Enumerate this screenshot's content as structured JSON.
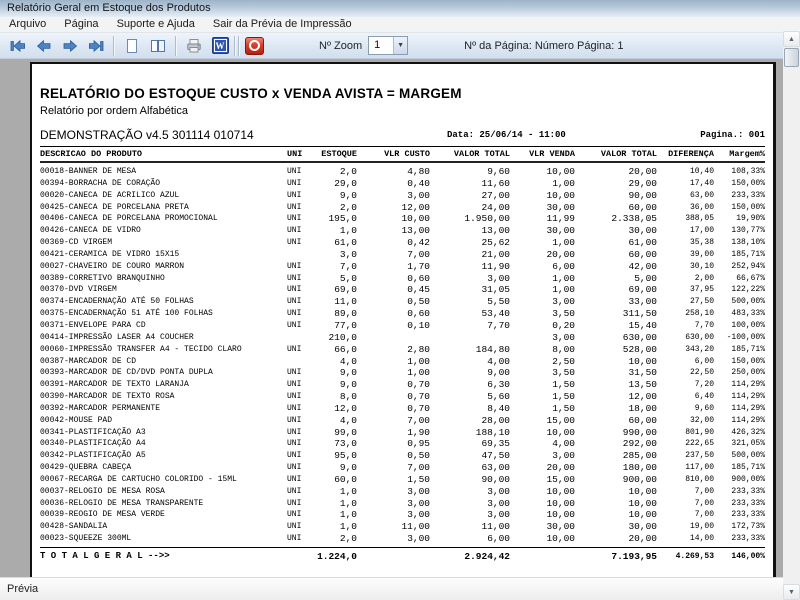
{
  "window": {
    "title": "Relatório Geral em Estoque dos Produtos"
  },
  "menu": {
    "items": [
      "Arquivo",
      "Página",
      "Suporte e Ajuda",
      "Sair da Prévia de Impressão"
    ]
  },
  "toolbar": {
    "icons": [
      "first-page",
      "previous-page",
      "next-page",
      "last-page",
      "single-page-view",
      "two-page-view",
      "print",
      "export-word",
      "exit-preview"
    ],
    "zoom_label": "Nº Zoom",
    "zoom_value": "1",
    "page_info": "Nº da Página: Número Página: 1"
  },
  "colors": {
    "toolbar_bg": "#dde7f3",
    "preview_bg": "#ababab",
    "arrow_blue": "#4c83c3",
    "word_blue": "#2e55b0",
    "exit_red": "#c0392b"
  },
  "report": {
    "title": "RELATÓRIO DO ESTOQUE CUSTO x VENDA AVISTA = MARGEM",
    "subtitle": "Relatório por ordem Alfabética",
    "version": "DEMONSTRAÇÃO v4.5 301114 010714",
    "date_label": "Data: 25/06/14 - 11:00",
    "page_label": "Pagina.: 001",
    "columns": [
      "DESCRICAO DO PRODUTO",
      "UNI",
      "ESTOQUE",
      "VLR CUSTO",
      "VALOR TOTAL",
      "VLR VENDA",
      "VALOR TOTAL",
      "DIFERENÇA",
      "Margem%"
    ],
    "rows": [
      [
        "00018-BANNER DE MESA",
        "UNI",
        "2,0",
        "4,80",
        "9,60",
        "10,00",
        "20,00",
        "10,40",
        "108,33%"
      ],
      [
        "00394-BORRACHA DE CORAÇÃO",
        "UNI",
        "29,0",
        "0,40",
        "11,60",
        "1,00",
        "29,00",
        "17,40",
        "150,00%"
      ],
      [
        "00020-CANECA DE ACRILICO AZUL",
        "UNI",
        "9,0",
        "3,00",
        "27,00",
        "10,00",
        "90,00",
        "63,00",
        "233,33%"
      ],
      [
        "00425-CANECA DE PORCELANA PRETA",
        "UNI",
        "2,0",
        "12,00",
        "24,00",
        "30,00",
        "60,00",
        "36,00",
        "150,00%"
      ],
      [
        "00406-CANECA DE PORCELANA PROMOCIONAL",
        "UNI",
        "195,0",
        "10,00",
        "1.950,00",
        "11,99",
        "2.338,05",
        "388,05",
        "19,90%"
      ],
      [
        "00426-CANECA DE VIDRO",
        "UNI",
        "1,0",
        "13,00",
        "13,00",
        "30,00",
        "30,00",
        "17,00",
        "130,77%"
      ],
      [
        "00369-CD VIRGEM",
        "UNI",
        "61,0",
        "0,42",
        "25,62",
        "1,00",
        "61,00",
        "35,38",
        "138,10%"
      ],
      [
        "00421-CERAMICA DE VIDRO 15X15",
        "",
        "3,0",
        "7,00",
        "21,00",
        "20,00",
        "60,00",
        "39,00",
        "185,71%"
      ],
      [
        "00027-CHAVEIRO DE COURO MARRON",
        "UNI",
        "7,0",
        "1,70",
        "11,90",
        "6,00",
        "42,00",
        "30,10",
        "252,94%"
      ],
      [
        "00389-CORRETIVO BRANQUINHO",
        "UNI",
        "5,0",
        "0,60",
        "3,00",
        "1,00",
        "5,00",
        "2,00",
        "66,67%"
      ],
      [
        "00370-DVD VIRGEM",
        "UNI",
        "69,0",
        "0,45",
        "31,05",
        "1,00",
        "69,00",
        "37,95",
        "122,22%"
      ],
      [
        "00374-ENCADERNAÇÃO  ATÉ 50 FOLHAS",
        "UNI",
        "11,0",
        "0,50",
        "5,50",
        "3,00",
        "33,00",
        "27,50",
        "500,00%"
      ],
      [
        "00375-ENCADERNAÇÃO 51 ATÉ 100 FOLHAS",
        "UNI",
        "89,0",
        "0,60",
        "53,40",
        "3,50",
        "311,50",
        "258,10",
        "483,33%"
      ],
      [
        "00371-ENVELOPE PARA CD",
        "UNI",
        "77,0",
        "0,10",
        "7,70",
        "0,20",
        "15,40",
        "7,70",
        "100,00%"
      ],
      [
        "00414-IMPRESSÃO LASER A4 COUCHER",
        "",
        "210,0",
        "",
        "",
        "3,00",
        "630,00",
        "630,00",
        "-100,00%"
      ],
      [
        "00060-IMPRESSÃO TRANSFER A4 - TECIDO CLARO",
        "UNI",
        "66,0",
        "2,80",
        "184,80",
        "8,00",
        "528,00",
        "343,20",
        "185,71%"
      ],
      [
        "00387-MARCADOR DE CD",
        "",
        "4,0",
        "1,00",
        "4,00",
        "2,50",
        "10,00",
        "6,00",
        "150,00%"
      ],
      [
        "00393-MARCADOR DE CD/DVD PONTA DUPLA",
        "UNI",
        "9,0",
        "1,00",
        "9,00",
        "3,50",
        "31,50",
        "22,50",
        "250,00%"
      ],
      [
        "00391-MARCADOR DE TEXTO LARANJA",
        "UNI",
        "9,0",
        "0,70",
        "6,30",
        "1,50",
        "13,50",
        "7,20",
        "114,29%"
      ],
      [
        "00390-MARCADOR DE TEXTO ROSA",
        "UNI",
        "8,0",
        "0,70",
        "5,60",
        "1,50",
        "12,00",
        "6,40",
        "114,29%"
      ],
      [
        "00392-MARCADOR PERMANENTE",
        "UNI",
        "12,0",
        "0,70",
        "8,40",
        "1,50",
        "18,00",
        "9,60",
        "114,29%"
      ],
      [
        "00042-MOUSE PAD",
        "UNI",
        "4,0",
        "7,00",
        "28,00",
        "15,00",
        "60,00",
        "32,00",
        "114,29%"
      ],
      [
        "00341-PLASTIFICAÇÃO A3",
        "UNI",
        "99,0",
        "1,90",
        "188,10",
        "10,00",
        "990,00",
        "801,90",
        "426,32%"
      ],
      [
        "00340-PLASTIFICAÇÃO A4",
        "UNI",
        "73,0",
        "0,95",
        "69,35",
        "4,00",
        "292,00",
        "222,65",
        "321,05%"
      ],
      [
        "00342-PLASTIFICAÇÃO A5",
        "UNI",
        "95,0",
        "0,50",
        "47,50",
        "3,00",
        "285,00",
        "237,50",
        "500,00%"
      ],
      [
        "00429-QUEBRA CABEÇA",
        "UNI",
        "9,0",
        "7,00",
        "63,00",
        "20,00",
        "180,00",
        "117,00",
        "185,71%"
      ],
      [
        "00067-RECARGA DE CARTUCHO COLORIDO - 15ML",
        "UNI",
        "60,0",
        "1,50",
        "90,00",
        "15,00",
        "900,00",
        "810,00",
        "900,00%"
      ],
      [
        "00037-RELOGIO DE MESA ROSA",
        "UNI",
        "1,0",
        "3,00",
        "3,00",
        "10,00",
        "10,00",
        "7,00",
        "233,33%"
      ],
      [
        "00036-RELOGIO DE MESA TRANSPARENTE",
        "UNI",
        "1,0",
        "3,00",
        "3,00",
        "10,00",
        "10,00",
        "7,00",
        "233,33%"
      ],
      [
        "00039-REOGIO DE MESA VERDE",
        "UNI",
        "1,0",
        "3,00",
        "3,00",
        "10,00",
        "10,00",
        "7,00",
        "233,33%"
      ],
      [
        "00428-SANDALIA",
        "UNI",
        "1,0",
        "11,00",
        "11,00",
        "30,00",
        "30,00",
        "19,00",
        "172,73%"
      ],
      [
        "00023-SQUEEZE 300ML",
        "UNI",
        "2,0",
        "3,00",
        "6,00",
        "10,00",
        "20,00",
        "14,00",
        "233,33%"
      ]
    ],
    "total": {
      "label": "T O T A L   G E R A L   -->>",
      "estoque": "1.224,0",
      "valor_total_custo": "2.924,42",
      "valor_total_venda": "7.193,95",
      "diferenca": "4.269,53",
      "margem": "146,00%"
    }
  },
  "statusbar": {
    "text": "Prévia"
  }
}
